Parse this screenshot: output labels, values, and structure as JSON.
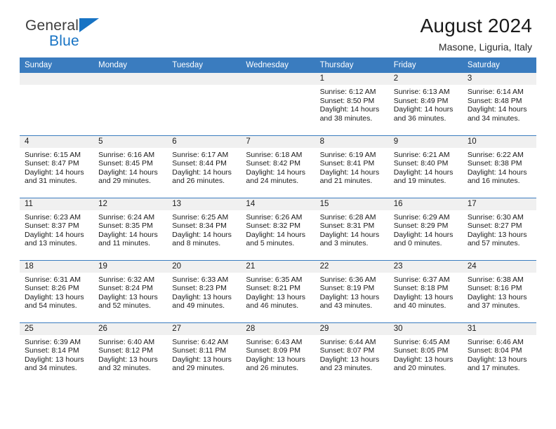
{
  "brand": {
    "line1": "General",
    "line2": "Blue",
    "logo_triangle_color": "#1773c4",
    "line1_color": "#3c3c3c",
    "line2_color": "#1773c4"
  },
  "header": {
    "title": "August 2024",
    "subtitle": "Masone, Liguria, Italy"
  },
  "theme": {
    "header_blue": "#3a7cbf",
    "daynum_gray": "#f0f0f0",
    "text": "#1a1a1a"
  },
  "weekdays": [
    "Sunday",
    "Monday",
    "Tuesday",
    "Wednesday",
    "Thursday",
    "Friday",
    "Saturday"
  ],
  "weeks": [
    [
      {
        "day": "",
        "sunrise": "",
        "sunset": "",
        "daylight1": "",
        "daylight2": ""
      },
      {
        "day": "",
        "sunrise": "",
        "sunset": "",
        "daylight1": "",
        "daylight2": ""
      },
      {
        "day": "",
        "sunrise": "",
        "sunset": "",
        "daylight1": "",
        "daylight2": ""
      },
      {
        "day": "",
        "sunrise": "",
        "sunset": "",
        "daylight1": "",
        "daylight2": ""
      },
      {
        "day": "1",
        "sunrise": "Sunrise: 6:12 AM",
        "sunset": "Sunset: 8:50 PM",
        "daylight1": "Daylight: 14 hours",
        "daylight2": "and 38 minutes."
      },
      {
        "day": "2",
        "sunrise": "Sunrise: 6:13 AM",
        "sunset": "Sunset: 8:49 PM",
        "daylight1": "Daylight: 14 hours",
        "daylight2": "and 36 minutes."
      },
      {
        "day": "3",
        "sunrise": "Sunrise: 6:14 AM",
        "sunset": "Sunset: 8:48 PM",
        "daylight1": "Daylight: 14 hours",
        "daylight2": "and 34 minutes."
      }
    ],
    [
      {
        "day": "4",
        "sunrise": "Sunrise: 6:15 AM",
        "sunset": "Sunset: 8:47 PM",
        "daylight1": "Daylight: 14 hours",
        "daylight2": "and 31 minutes."
      },
      {
        "day": "5",
        "sunrise": "Sunrise: 6:16 AM",
        "sunset": "Sunset: 8:45 PM",
        "daylight1": "Daylight: 14 hours",
        "daylight2": "and 29 minutes."
      },
      {
        "day": "6",
        "sunrise": "Sunrise: 6:17 AM",
        "sunset": "Sunset: 8:44 PM",
        "daylight1": "Daylight: 14 hours",
        "daylight2": "and 26 minutes."
      },
      {
        "day": "7",
        "sunrise": "Sunrise: 6:18 AM",
        "sunset": "Sunset: 8:42 PM",
        "daylight1": "Daylight: 14 hours",
        "daylight2": "and 24 minutes."
      },
      {
        "day": "8",
        "sunrise": "Sunrise: 6:19 AM",
        "sunset": "Sunset: 8:41 PM",
        "daylight1": "Daylight: 14 hours",
        "daylight2": "and 21 minutes."
      },
      {
        "day": "9",
        "sunrise": "Sunrise: 6:21 AM",
        "sunset": "Sunset: 8:40 PM",
        "daylight1": "Daylight: 14 hours",
        "daylight2": "and 19 minutes."
      },
      {
        "day": "10",
        "sunrise": "Sunrise: 6:22 AM",
        "sunset": "Sunset: 8:38 PM",
        "daylight1": "Daylight: 14 hours",
        "daylight2": "and 16 minutes."
      }
    ],
    [
      {
        "day": "11",
        "sunrise": "Sunrise: 6:23 AM",
        "sunset": "Sunset: 8:37 PM",
        "daylight1": "Daylight: 14 hours",
        "daylight2": "and 13 minutes."
      },
      {
        "day": "12",
        "sunrise": "Sunrise: 6:24 AM",
        "sunset": "Sunset: 8:35 PM",
        "daylight1": "Daylight: 14 hours",
        "daylight2": "and 11 minutes."
      },
      {
        "day": "13",
        "sunrise": "Sunrise: 6:25 AM",
        "sunset": "Sunset: 8:34 PM",
        "daylight1": "Daylight: 14 hours",
        "daylight2": "and 8 minutes."
      },
      {
        "day": "14",
        "sunrise": "Sunrise: 6:26 AM",
        "sunset": "Sunset: 8:32 PM",
        "daylight1": "Daylight: 14 hours",
        "daylight2": "and 5 minutes."
      },
      {
        "day": "15",
        "sunrise": "Sunrise: 6:28 AM",
        "sunset": "Sunset: 8:31 PM",
        "daylight1": "Daylight: 14 hours",
        "daylight2": "and 3 minutes."
      },
      {
        "day": "16",
        "sunrise": "Sunrise: 6:29 AM",
        "sunset": "Sunset: 8:29 PM",
        "daylight1": "Daylight: 14 hours",
        "daylight2": "and 0 minutes."
      },
      {
        "day": "17",
        "sunrise": "Sunrise: 6:30 AM",
        "sunset": "Sunset: 8:27 PM",
        "daylight1": "Daylight: 13 hours",
        "daylight2": "and 57 minutes."
      }
    ],
    [
      {
        "day": "18",
        "sunrise": "Sunrise: 6:31 AM",
        "sunset": "Sunset: 8:26 PM",
        "daylight1": "Daylight: 13 hours",
        "daylight2": "and 54 minutes."
      },
      {
        "day": "19",
        "sunrise": "Sunrise: 6:32 AM",
        "sunset": "Sunset: 8:24 PM",
        "daylight1": "Daylight: 13 hours",
        "daylight2": "and 52 minutes."
      },
      {
        "day": "20",
        "sunrise": "Sunrise: 6:33 AM",
        "sunset": "Sunset: 8:23 PM",
        "daylight1": "Daylight: 13 hours",
        "daylight2": "and 49 minutes."
      },
      {
        "day": "21",
        "sunrise": "Sunrise: 6:35 AM",
        "sunset": "Sunset: 8:21 PM",
        "daylight1": "Daylight: 13 hours",
        "daylight2": "and 46 minutes."
      },
      {
        "day": "22",
        "sunrise": "Sunrise: 6:36 AM",
        "sunset": "Sunset: 8:19 PM",
        "daylight1": "Daylight: 13 hours",
        "daylight2": "and 43 minutes."
      },
      {
        "day": "23",
        "sunrise": "Sunrise: 6:37 AM",
        "sunset": "Sunset: 8:18 PM",
        "daylight1": "Daylight: 13 hours",
        "daylight2": "and 40 minutes."
      },
      {
        "day": "24",
        "sunrise": "Sunrise: 6:38 AM",
        "sunset": "Sunset: 8:16 PM",
        "daylight1": "Daylight: 13 hours",
        "daylight2": "and 37 minutes."
      }
    ],
    [
      {
        "day": "25",
        "sunrise": "Sunrise: 6:39 AM",
        "sunset": "Sunset: 8:14 PM",
        "daylight1": "Daylight: 13 hours",
        "daylight2": "and 34 minutes."
      },
      {
        "day": "26",
        "sunrise": "Sunrise: 6:40 AM",
        "sunset": "Sunset: 8:12 PM",
        "daylight1": "Daylight: 13 hours",
        "daylight2": "and 32 minutes."
      },
      {
        "day": "27",
        "sunrise": "Sunrise: 6:42 AM",
        "sunset": "Sunset: 8:11 PM",
        "daylight1": "Daylight: 13 hours",
        "daylight2": "and 29 minutes."
      },
      {
        "day": "28",
        "sunrise": "Sunrise: 6:43 AM",
        "sunset": "Sunset: 8:09 PM",
        "daylight1": "Daylight: 13 hours",
        "daylight2": "and 26 minutes."
      },
      {
        "day": "29",
        "sunrise": "Sunrise: 6:44 AM",
        "sunset": "Sunset: 8:07 PM",
        "daylight1": "Daylight: 13 hours",
        "daylight2": "and 23 minutes."
      },
      {
        "day": "30",
        "sunrise": "Sunrise: 6:45 AM",
        "sunset": "Sunset: 8:05 PM",
        "daylight1": "Daylight: 13 hours",
        "daylight2": "and 20 minutes."
      },
      {
        "day": "31",
        "sunrise": "Sunrise: 6:46 AM",
        "sunset": "Sunset: 8:04 PM",
        "daylight1": "Daylight: 13 hours",
        "daylight2": "and 17 minutes."
      }
    ]
  ]
}
